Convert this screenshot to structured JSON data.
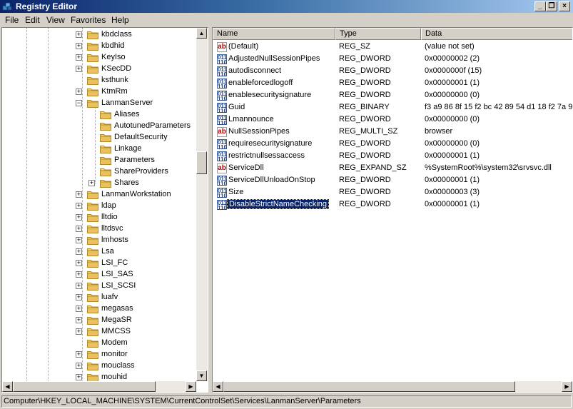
{
  "window": {
    "title": "Registry Editor"
  },
  "menu": [
    "File",
    "Edit",
    "View",
    "Favorites",
    "Help"
  ],
  "tree": [
    {
      "label": "kbdclass",
      "state": "collapsed",
      "level": 1
    },
    {
      "label": "kbdhid",
      "state": "collapsed",
      "level": 1
    },
    {
      "label": "KeyIso",
      "state": "collapsed",
      "level": 1
    },
    {
      "label": "KSecDD",
      "state": "collapsed",
      "level": 1
    },
    {
      "label": "ksthunk",
      "state": "none",
      "level": 1
    },
    {
      "label": "KtmRm",
      "state": "collapsed",
      "level": 1
    },
    {
      "label": "LanmanServer",
      "state": "expanded",
      "level": 1
    },
    {
      "label": "Aliases",
      "state": "none",
      "level": 2
    },
    {
      "label": "AutotunedParameters",
      "state": "none",
      "level": 2
    },
    {
      "label": "DefaultSecurity",
      "state": "none",
      "level": 2
    },
    {
      "label": "Linkage",
      "state": "none",
      "level": 2
    },
    {
      "label": "Parameters",
      "state": "none",
      "level": 2
    },
    {
      "label": "ShareProviders",
      "state": "none",
      "level": 2
    },
    {
      "label": "Shares",
      "state": "collapsed",
      "level": 2
    },
    {
      "label": "LanmanWorkstation",
      "state": "collapsed",
      "level": 1
    },
    {
      "label": "ldap",
      "state": "collapsed",
      "level": 1
    },
    {
      "label": "lltdio",
      "state": "collapsed",
      "level": 1
    },
    {
      "label": "lltdsvc",
      "state": "collapsed",
      "level": 1
    },
    {
      "label": "lmhosts",
      "state": "collapsed",
      "level": 1
    },
    {
      "label": "Lsa",
      "state": "collapsed",
      "level": 1
    },
    {
      "label": "LSI_FC",
      "state": "collapsed",
      "level": 1
    },
    {
      "label": "LSI_SAS",
      "state": "collapsed",
      "level": 1
    },
    {
      "label": "LSI_SCSI",
      "state": "collapsed",
      "level": 1
    },
    {
      "label": "luafv",
      "state": "collapsed",
      "level": 1
    },
    {
      "label": "megasas",
      "state": "collapsed",
      "level": 1
    },
    {
      "label": "MegaSR",
      "state": "collapsed",
      "level": 1
    },
    {
      "label": "MMCSS",
      "state": "collapsed",
      "level": 1
    },
    {
      "label": "Modem",
      "state": "none",
      "level": 1
    },
    {
      "label": "monitor",
      "state": "collapsed",
      "level": 1
    },
    {
      "label": "mouclass",
      "state": "collapsed",
      "level": 1
    },
    {
      "label": "mouhid",
      "state": "collapsed",
      "level": 1
    }
  ],
  "columns": {
    "name": "Name",
    "type": "Type",
    "data": "Data"
  },
  "values": [
    {
      "icon": "string",
      "name": "(Default)",
      "type": "REG_SZ",
      "data": "(value not set)"
    },
    {
      "icon": "binary",
      "name": "AdjustedNullSessionPipes",
      "type": "REG_DWORD",
      "data": "0x00000002 (2)"
    },
    {
      "icon": "binary",
      "name": "autodisconnect",
      "type": "REG_DWORD",
      "data": "0x0000000f (15)"
    },
    {
      "icon": "binary",
      "name": "enableforcedlogoff",
      "type": "REG_DWORD",
      "data": "0x00000001 (1)"
    },
    {
      "icon": "binary",
      "name": "enablesecuritysignature",
      "type": "REG_DWORD",
      "data": "0x00000000 (0)"
    },
    {
      "icon": "binary",
      "name": "Guid",
      "type": "REG_BINARY",
      "data": "f3 a9 86 8f 15 f2 bc 42 89 54 d1 18 f2 7a 9"
    },
    {
      "icon": "binary",
      "name": "Lmannounce",
      "type": "REG_DWORD",
      "data": "0x00000000 (0)"
    },
    {
      "icon": "string",
      "name": "NullSessionPipes",
      "type": "REG_MULTI_SZ",
      "data": "browser"
    },
    {
      "icon": "binary",
      "name": "requiresecuritysignature",
      "type": "REG_DWORD",
      "data": "0x00000000 (0)"
    },
    {
      "icon": "binary",
      "name": "restrictnullsessaccess",
      "type": "REG_DWORD",
      "data": "0x00000001 (1)"
    },
    {
      "icon": "string",
      "name": "ServiceDll",
      "type": "REG_EXPAND_SZ",
      "data": "%SystemRoot%\\system32\\srvsvc.dll"
    },
    {
      "icon": "binary",
      "name": "ServiceDllUnloadOnStop",
      "type": "REG_DWORD",
      "data": "0x00000001 (1)"
    },
    {
      "icon": "binary",
      "name": "Size",
      "type": "REG_DWORD",
      "data": "0x00000003 (3)"
    },
    {
      "icon": "binary",
      "name": "DisableStrictNameChecking",
      "type": "REG_DWORD",
      "data": "0x00000001 (1)",
      "selected": true
    }
  ],
  "status": {
    "path": "Computer\\HKEY_LOCAL_MACHINE\\SYSTEM\\CurrentControlSet\\Services\\LanmanServer\\Parameters"
  },
  "colors": {
    "selection": "#0a246a",
    "chrome": "#d4d0c8",
    "folder": "#e8c25a"
  }
}
